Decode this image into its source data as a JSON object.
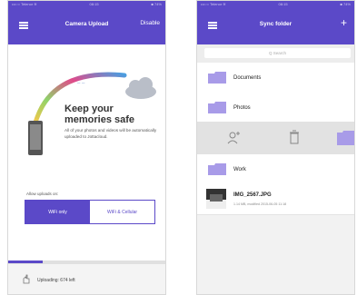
{
  "screen1": {
    "status_left": "•••○○ Telenor ≋",
    "status_time": "08:15",
    "status_right": "■ 74%",
    "title": "Camera Upload",
    "right_action": "Disable",
    "heading": "Keep your memories safe",
    "subtext": "All of your photos and videos will be automatically uploaded to Jottacloud.",
    "allow_label": "Allow uploads on:",
    "seg_wifi": "WiFi only",
    "seg_both": "WiFi & Cellular",
    "upload_label": "Uploading: 674 left",
    "progress_fraction": 0.22
  },
  "screen2": {
    "status_left": "•••○○ Telenor ≋",
    "status_time": "08:15",
    "status_right": "■ 74%",
    "title": "Sync folder",
    "add": "+",
    "search_placeholder": "Q Search",
    "folders": [
      "Documents",
      "Photos",
      "Work"
    ],
    "file_name": "IMG_2567.JPG",
    "file_meta": "1.14 MB, modified 2015-06-05 11:18"
  },
  "colors": {
    "brand": "#5b49c8",
    "folder": "#a89be8",
    "arc_start": "#f5c84a",
    "arc_mid": "#e04a8a",
    "arc_end": "#4a9ee0"
  }
}
